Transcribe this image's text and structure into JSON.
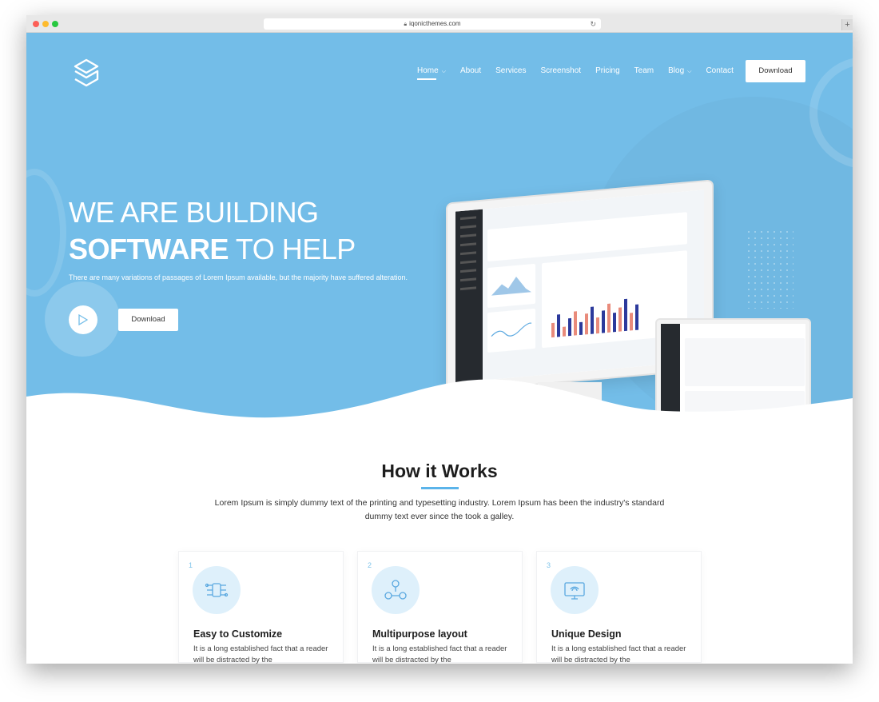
{
  "browser": {
    "url": "iqonicthemes.com"
  },
  "nav": {
    "items": [
      {
        "label": "Home",
        "dropdown": true,
        "active": true
      },
      {
        "label": "About"
      },
      {
        "label": "Services"
      },
      {
        "label": "Screenshot"
      },
      {
        "label": "Pricing"
      },
      {
        "label": "Team"
      },
      {
        "label": "Blog",
        "dropdown": true
      },
      {
        "label": "Contact"
      }
    ],
    "download_label": "Download"
  },
  "hero": {
    "title_line1": "WE ARE BUILDING",
    "title_line2_bold": "SOFTWARE",
    "title_line2_rest": " TO HELP",
    "subtitle": "There are many variations of passages of Lorem Ipsum available, but the majority have suffered alteration.",
    "download_label": "Download",
    "accent_color": "#73bde8"
  },
  "how_it_works": {
    "title": "How it Works",
    "description": "Lorem Ipsum is simply dummy text of the printing and typesetting industry. Lorem Ipsum has been the industry's standard dummy text ever since the took a galley.",
    "features": [
      {
        "number": "1",
        "title": "Easy to Customize",
        "text": "It is a long established fact that a reader will be distracted by the",
        "icon": "circuit-icon"
      },
      {
        "number": "2",
        "title": "Multipurpose layout",
        "text": "It is a long established fact that a reader will be distracted by the",
        "icon": "network-icon"
      },
      {
        "number": "3",
        "title": "Unique Design",
        "text": "It is a long established fact that a reader will be distracted by the",
        "icon": "monitor-icon"
      }
    ]
  }
}
